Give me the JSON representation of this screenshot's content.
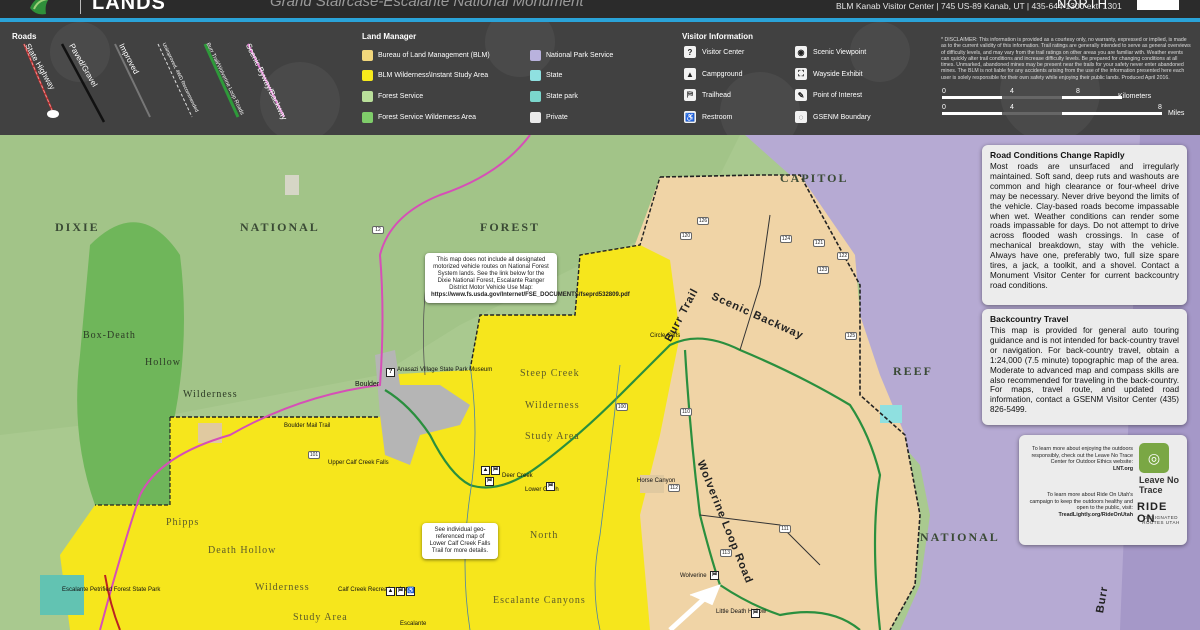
{
  "header": {
    "brand": "LANDS",
    "subtitle": "Grand Staircase-Escalante National Monument",
    "contact": "BLM Kanab Visitor Center | 745 US-89 Kanab, UT | 435-644-1300 ext. 1301",
    "north": "NORTH"
  },
  "legend": {
    "roads_title": "Roads",
    "roads": [
      "State Highway",
      "Paved/Gravel",
      "Improved",
      "Unimproved, 4WD Recommended",
      "Burr Trail/Wolverine Loop Roads",
      "Scenic Byway/Backway"
    ],
    "land_title": "Land Manager",
    "land": [
      {
        "label": "Bureau of Land Management (BLM)",
        "color": "#f2d77c"
      },
      {
        "label": "BLM Wilderness\\Instant Study Area",
        "color": "#f7ea1c"
      },
      {
        "label": "Forest Service",
        "color": "#b9df9a"
      },
      {
        "label": "Forest Service Wilderness Area",
        "color": "#7fcd6a"
      },
      {
        "label": "National Park Service",
        "color": "#b9b2dd"
      },
      {
        "label": "State",
        "color": "#8fe0e0"
      },
      {
        "label": "State park",
        "color": "#7bd6cc"
      },
      {
        "label": "Private",
        "color": "#e9e9e9"
      }
    ],
    "visitor_title": "Visitor Information",
    "visitor": [
      {
        "label": "Visitor Center",
        "icon": "?"
      },
      {
        "label": "Campground",
        "icon": "▲"
      },
      {
        "label": "Trailhead",
        "icon": "⛿"
      },
      {
        "label": "Restroom",
        "icon": "♿"
      },
      {
        "label": "Scenic Viewpoint",
        "icon": "◉"
      },
      {
        "label": "Wayside Exhibit",
        "icon": "⛶"
      },
      {
        "label": "Point of Interest",
        "icon": "✎"
      },
      {
        "label": "GSENM Boundary",
        "icon": "◌"
      }
    ],
    "disclaimer": "* DISCLAIMER: This information is provided as a courtesy only, no warranty, expressed or implied, is made as to the current validity of this information. Trail ratings are generally intended to serve as general overviews of difficulty levels, and may vary from the trail ratings on other areas you are familiar with. Weather events can quickly alter trail conditions and increase difficulty levels. Be prepared for changing conditions at all times. Unmarked, abandoned mines may be present near the trails for your safety never enter abandoned mines. The BLM is not liable for any accidents arising from the use of the information presented here each user is solely responsible for their own safety while enjoying their public lands. Produced April 2016.",
    "scale_km": [
      "0",
      "4",
      "8",
      "Kilometers"
    ],
    "scale_mi": [
      "0",
      "4",
      "8",
      "Miles"
    ]
  },
  "map": {
    "regions": [
      "DIXIE",
      "NATIONAL",
      "FOREST",
      "CAPITOL",
      "REEF",
      "NATIONAL"
    ],
    "wilderness_labels": [
      "Box-Death",
      "Hollow",
      "Wilderness",
      "Steep Creek",
      "Wilderness",
      "Study Area",
      "North",
      "Escalante Canyons",
      "Phipps",
      "Death Hollow",
      "Wilderness",
      "Study Area"
    ],
    "towns": [
      "Boulder",
      "Anasazi Village State Park Museum",
      "Boulder Mail Trail",
      "Upper Calf Creek Falls",
      "Deer Creek",
      "Lower Gulch",
      "Horse Canyon",
      "Circle Cliffs",
      "Wolverine",
      "Little Death Hollow",
      "Calf Creek Recreation Area",
      "Escalante Petrified Forest State Park",
      "Escalante"
    ],
    "routes": [
      "Burr Trail",
      "Scenic Backway",
      "Wolverine Loop Road",
      "Burr"
    ],
    "shields": [
      "12",
      "100",
      "101",
      "110",
      "111",
      "112",
      "113",
      "120",
      "121",
      "122",
      "123",
      "124",
      "125",
      "126"
    ],
    "callout_fs": "This map does not include all designated motorized vehicle routes on National Forest System lands. See the link below for the Dixie National Forest, Escalante Ranger District Motor Vehicle Use Map:",
    "callout_fs_link": "https://www.fs.usda.gov/Internet/FSE_DOCUMENTS/fseprd532809.pdf",
    "callout_lcc": "See individual geo-referenced map of Lower Calf Creek Falls Trail for more details."
  },
  "info": {
    "road_title": "Road Conditions Change Rapidly",
    "road_text": "Most roads are unsurfaced and irregularly maintained. Soft sand, deep ruts and washouts are common and high clearance or four-wheel drive may be necessary. Never drive beyond the limits of the vehicle. Clay-based roads become impassable when wet. Weather conditions can render some roads impassable for days. Do not attempt to drive across flooded wash crossings. In case of mechanical breakdown, stay with the vehicle. Always have one, preferably two, full size spare tires, a jack, a toolkit, and a shovel. Contact a Monument Visitor Center for current backcountry road conditions.",
    "back_title": "Backcountry Travel",
    "back_text": "This map is provided for general auto touring guidance and is not intended for back-country travel or navigation. For back-country travel, obtain a 1:24,000 (7.5 minute) topographic map of the area. Moderate to advanced map and compass skills are also recommended for traveling in the back-country. For maps, travel route, and updated road information, contact a GSENM Visitor Center (435) 826-5499.",
    "lnt_text": "To learn more about enjoying the outdoors responsibly, check out the Leave No Trace Center for Outdoor Ethics website:",
    "lnt_link": "LNT.org",
    "lnt_logo": "Leave No Trace",
    "ride_text": "To learn more about Ride On Utah's campaign to keep the outdoors healthy and open to the public, visit:",
    "ride_link": "TreadLightly.org/RideOnUtah",
    "ride_logo": "RIDE ON",
    "ride_sub": "DESIGNATED ROUTES UTAH"
  }
}
